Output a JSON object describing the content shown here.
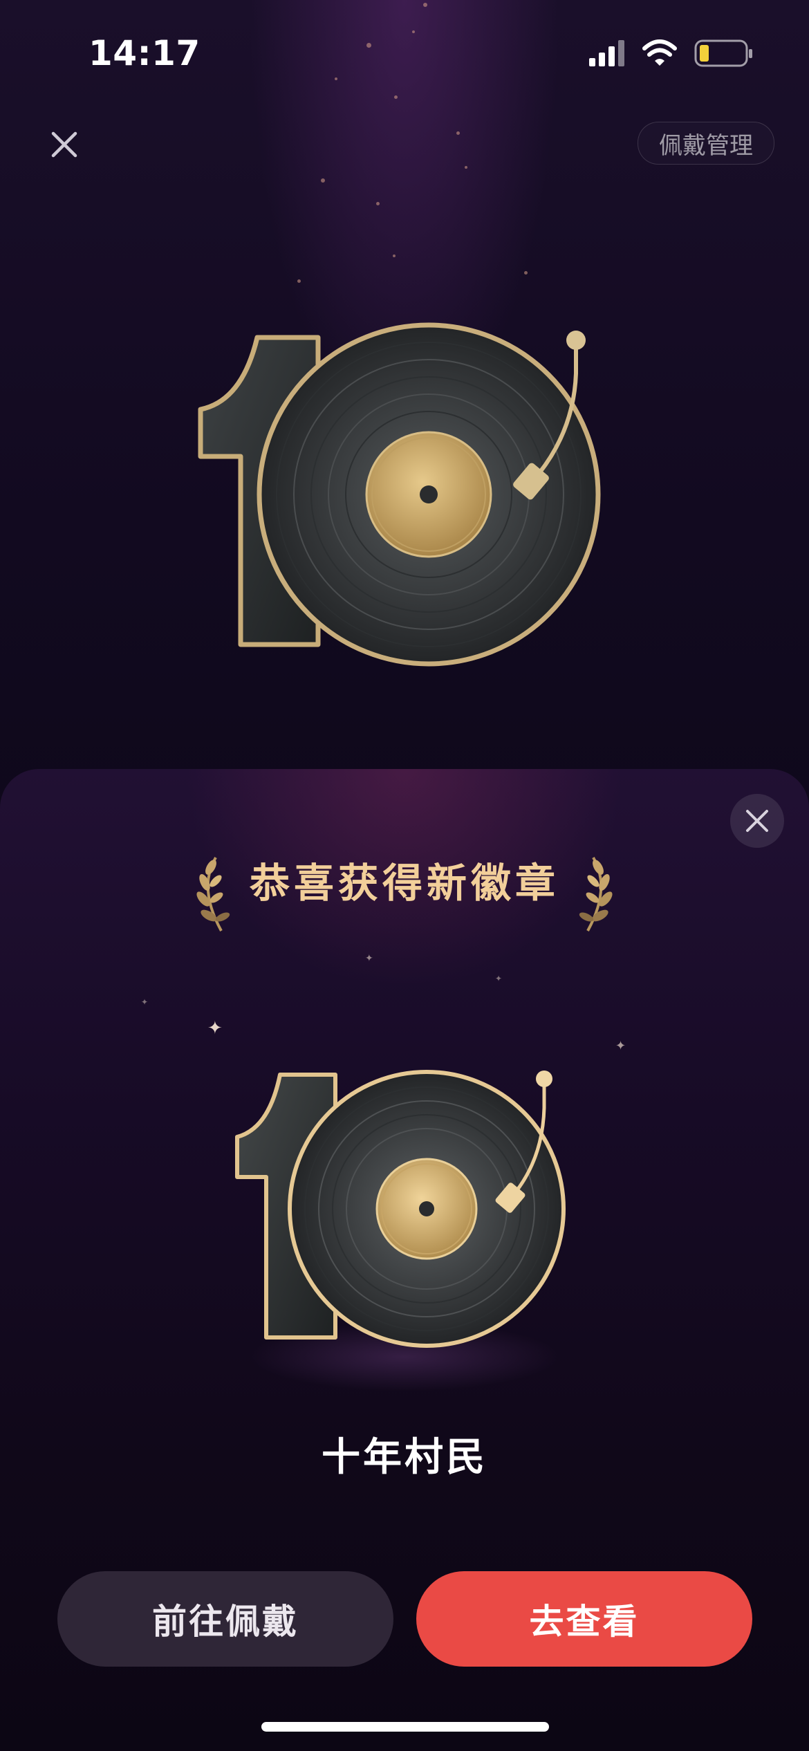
{
  "status_bar": {
    "time": "14:17",
    "signal_icon": "cellular-signal-icon",
    "wifi_icon": "wifi-icon",
    "battery_icon": "battery-low-icon",
    "battery_level": 0.15
  },
  "header": {
    "close_icon": "close-icon",
    "manage_label": "佩戴管理"
  },
  "badge": {
    "art": "vinyl-record-10-badge",
    "name": "十年村民"
  },
  "sheet": {
    "title": "恭喜获得新徽章",
    "close_icon": "close-icon",
    "laurel_icon": "laurel-icon"
  },
  "actions": {
    "wear_label": "前往佩戴",
    "view_label": "去查看"
  },
  "colors": {
    "gold": "#f2cf9a",
    "accent_red": "#ea4a45",
    "secondary_button": "#2f2637"
  }
}
